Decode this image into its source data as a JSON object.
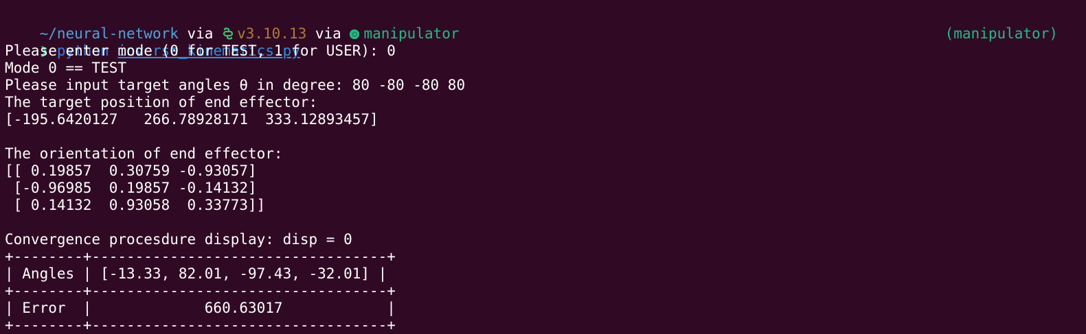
{
  "prompt": {
    "path": "~/neural-network",
    "via1": " via ",
    "python_version": "v3.10.13",
    "via2": " via ",
    "env_name": "manipulator",
    "arrow": "❯ ",
    "command": "python",
    "script": "inverse_kinematics.py",
    "right_context": "(manipulator)"
  },
  "output_lines": [
    "Please enter mode (0 for TEST, 1 for USER): 0",
    "Mode 0 == TEST",
    "Please input target angles θ in degree: 80 -80 -80 80",
    "The target position of end effector:",
    "[-195.6420127   266.78928171  333.12893457]",
    "",
    "The orientation of end effector:",
    "[[ 0.19857  0.30759 -0.93057]",
    " [-0.96985  0.19857 -0.14132]",
    " [ 0.14132  0.93058  0.33773]]",
    "",
    "Convergence procesdure display: disp = 0",
    "+--------+----------------------------------+",
    "| Angles | [-13.33, 82.01, -97.43, -32.01] |",
    "+--------+----------------------------------+",
    "| Error  |             660.63017            |",
    "+--------+----------------------------------+"
  ],
  "colors": {
    "background": "#300a24",
    "path": "#4fa3dc",
    "python_version": "#b07a3b",
    "env": "#26b985",
    "command": "#3e7ce0"
  },
  "icons": {
    "python": "python-snake-icon",
    "env": "circle-dot-icon"
  }
}
